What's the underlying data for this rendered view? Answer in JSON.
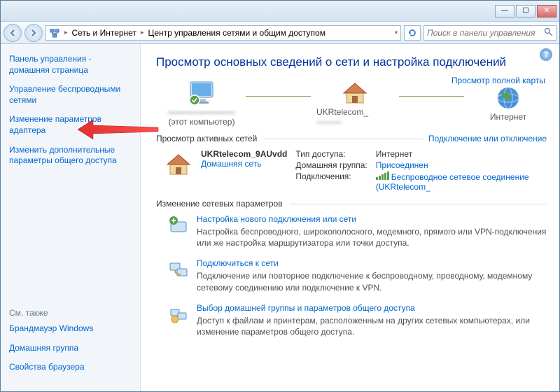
{
  "titlebar": {
    "min": "—",
    "max": "☐",
    "close": "✕"
  },
  "breadcrumb": {
    "item1": "Сеть и Интернет",
    "item2": "Центр управления сетями и общим доступом"
  },
  "search": {
    "placeholder": "Поиск в панели управления"
  },
  "sidebar": {
    "home": "Панель управления - домашняя страница",
    "items": [
      "Управление беспроводными сетями",
      "Изменение параметров адаптера",
      "Изменить дополнительные параметры общего доступа"
    ],
    "see_also_label": "См. также",
    "see_also": [
      "Брандмауэр Windows",
      "Домашняя группа",
      "Свойства браузера"
    ]
  },
  "main": {
    "heading": "Просмотр основных сведений о сети и настройка подключений",
    "full_map": "Просмотр полной карты",
    "node1_sub": "(этот компьютер)",
    "node2": "UKRtelecom_",
    "node3": "Интернет",
    "active_header": "Просмотр активных сетей",
    "active_right": "Подключение или отключение",
    "net_name": "UKRtelecom_9AUvdd",
    "net_type": "Домашняя сеть",
    "details": {
      "k1": "Тип доступа:",
      "v1": "Интернет",
      "k2": "Домашняя группа:",
      "v2": "Присоединен",
      "k3": "Подключения:",
      "v3": "Беспроводное сетевое соединение (UKRtelecom_"
    },
    "change_header": "Изменение сетевых параметров",
    "tasks": [
      {
        "title": "Настройка нового подключения или сети",
        "desc": "Настройка беспроводного, широкополосного, модемного, прямого или VPN-подключения или же настройка маршрутизатора или точки доступа."
      },
      {
        "title": "Подключиться к сети",
        "desc": "Подключение или повторное подключение к беспроводному, проводному, модемному сетевому соединению или подключение к VPN."
      },
      {
        "title": "Выбор домашней группы и параметров общего доступа",
        "desc": "Доступ к файлам и принтерам, расположенным на других сетевых компьютерах, или изменение параметров общего доступа."
      }
    ]
  }
}
